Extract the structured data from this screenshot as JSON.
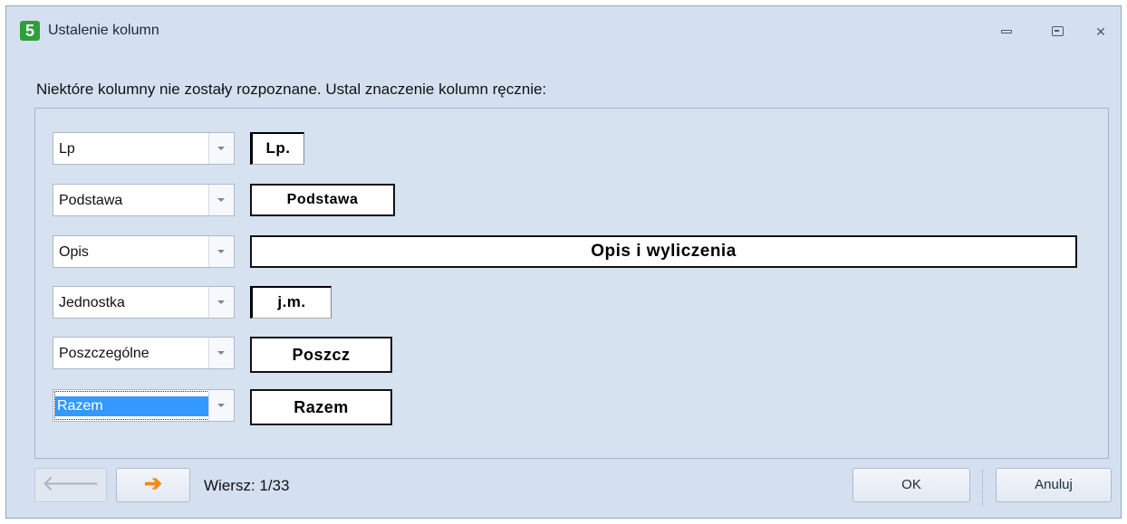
{
  "window": {
    "title": "Ustalenie kolumn",
    "app_icon_label": "5",
    "minimize_icon": "minimize-icon",
    "maximize_icon": "maximize-icon",
    "close_icon": "close-icon",
    "close_glyph": "✕"
  },
  "instruction": "Niektóre kolumny nie zostały rozpoznane. Ustal znaczenie kolumn ręcznie:",
  "rows": [
    {
      "selected_value": "Lp",
      "preview_text": "Lp."
    },
    {
      "selected_value": "Podstawa",
      "preview_text": "Podstawa"
    },
    {
      "selected_value": "Opis",
      "preview_text": "Opis i wyliczenia"
    },
    {
      "selected_value": "Jednostka",
      "preview_text": "j.m."
    },
    {
      "selected_value": "Poszczególne",
      "preview_text": "Poszcz"
    },
    {
      "selected_value": "Razem",
      "preview_text": "Razem"
    }
  ],
  "footer": {
    "prev_icon": "arrow-left-icon",
    "next_icon": "arrow-right-icon",
    "prev_glyph": "🡐",
    "next_glyph": "➔",
    "row_label": "Wiersz: 1/33",
    "ok_label": "OK",
    "cancel_label": "Anuluj"
  },
  "colors": {
    "window_bg": "#d4e0f0",
    "selection": "#3399ff",
    "next_arrow": "#f08a1c",
    "app_icon": "#2f9e3b"
  }
}
